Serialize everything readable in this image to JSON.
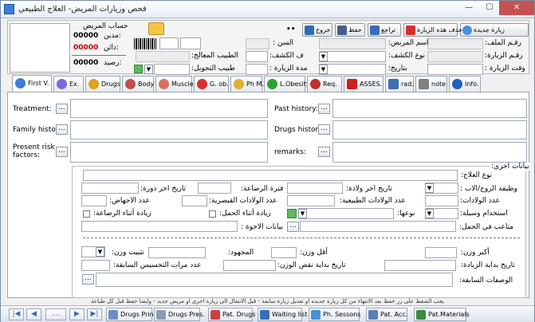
{
  "window": {
    "title": "فحص وزيارات المريض- العلاج الطبيعي",
    "min": "—",
    "max": "☐",
    "close": "✕"
  },
  "toolbar": {
    "new_visit": "زيارة جديدة",
    "delete_visit": "حذف هذه الزيارة",
    "undo": "تراجع",
    "save": "حفظ",
    "exit": "خروج",
    "dots": "••"
  },
  "patient_account": {
    "title": "حساب المريض",
    "debit_label": "مدين:",
    "debit_value": "00000",
    "credit_label": "دائن:",
    "credit_value": "00000",
    "balance_label": "رصيد:",
    "balance_value": "00000"
  },
  "form": {
    "file_no": "رقـم الملف:",
    "visit_no": "رقـم الزيارة:",
    "visit_time": "وقت الزيارة :",
    "patient_name": "اسم المريض:",
    "exam_type": "نوع الكشف:",
    "date": "بتاريخ:",
    "age": "السن :",
    "exam_fee": "ف الكشف:",
    "visit_duration": "مدة الزيارة :",
    "therapist": "الطبيب المعالج:",
    "referral_doctor": "طبيب التحويل:"
  },
  "tabs": [
    {
      "label": "First V.",
      "color": "#3b7dd8"
    },
    {
      "label": "Ex.",
      "color": "#7a6cd8"
    },
    {
      "label": "Drugs",
      "color": "#e0a020"
    },
    {
      "label": "Body",
      "color": "#c0504d"
    },
    {
      "label": "Muscle",
      "color": "#d87060"
    },
    {
      "label": "G. ob.",
      "color": "#d83030"
    },
    {
      "label": "Ph M.",
      "color": "#e0b030"
    },
    {
      "label": "L.Obesity",
      "color": "#30a030"
    },
    {
      "label": "Req.",
      "color": "#c03030"
    },
    {
      "label": "ASSES.",
      "color": "#d02020"
    },
    {
      "label": "rad.",
      "color": "#4070b0"
    },
    {
      "label": "note",
      "color": "#808080"
    },
    {
      "label": "Info.",
      "color": "#2060c0"
    }
  ],
  "first_visit": {
    "treatment": "Treatment:",
    "past_history": "Past history:",
    "family_history": "Family history:",
    "drugs_history": "Drugs history:",
    "present_risk": "Present risk factors:",
    "remarks": "remarks:"
  },
  "other_data": {
    "section": "بيانات اخرى:",
    "treatment_type": "نوع العلاج:",
    "husband_job": "وظيفة الزوج/الاب :",
    "last_birth_date": "تاريخ اخر ولادة:",
    "breastfeeding": "فترة الرضاعة:",
    "last_period": "تاريخ اخر دورة:",
    "births_count": "عدد الولادات:",
    "natural_births": "عدد الولادات الطبيعية:",
    "cesarean_births": "عدد الولادات القيصرية:",
    "abortions": "عدد الاجهاض:",
    "contraception": "استخدام وسيلة:",
    "its_type": "نوعها:",
    "weight_gain_pregnancy": "زيادة أثناء الحمل:",
    "weight_gain_breastfeeding": "زيادة أثناء الرضاعة:",
    "pregnancy_problems": "متاعب في الحمل:",
    "siblings_data": "بيانات الاخوة :",
    "max_weight": "أكبر وزن:",
    "min_weight": "أقل وزن:",
    "effort": "المجهود:",
    "weight_stable": "تثبيت وزن:",
    "gain_start_date": "تاريخ بداية الزيادة:",
    "loss_start_date": "تاريخ بداية نقص الوزن:",
    "prev_attempts": "عدد مرات التخسيس السابقة:",
    "prev_prescriptions": "الوصفات السابقة:"
  },
  "status_text": "يجب الضغط على زر حفظ بعد الانتهاء من كل زيارة جديده او تعديل زيارة سابقة - قبل الانتقال الى زيارة اخرى او مريض جديد - وايضا حفظ قبل كل طباعة",
  "bottom": {
    "first": "|◀",
    "prev": "◀",
    "page": "....",
    "next": "▶",
    "last": "▶|",
    "drugs_print": "Drugs Print",
    "drugs_pres": "Drugs Pres.",
    "pat_drugs": "Pat. Drugs",
    "waiting": "Waiting list",
    "ph_sessions": "Ph. Sessons",
    "pat_acc": "Pat. Acc.",
    "pat_materials": "Pat.Materials"
  },
  "ellipsis": "..."
}
